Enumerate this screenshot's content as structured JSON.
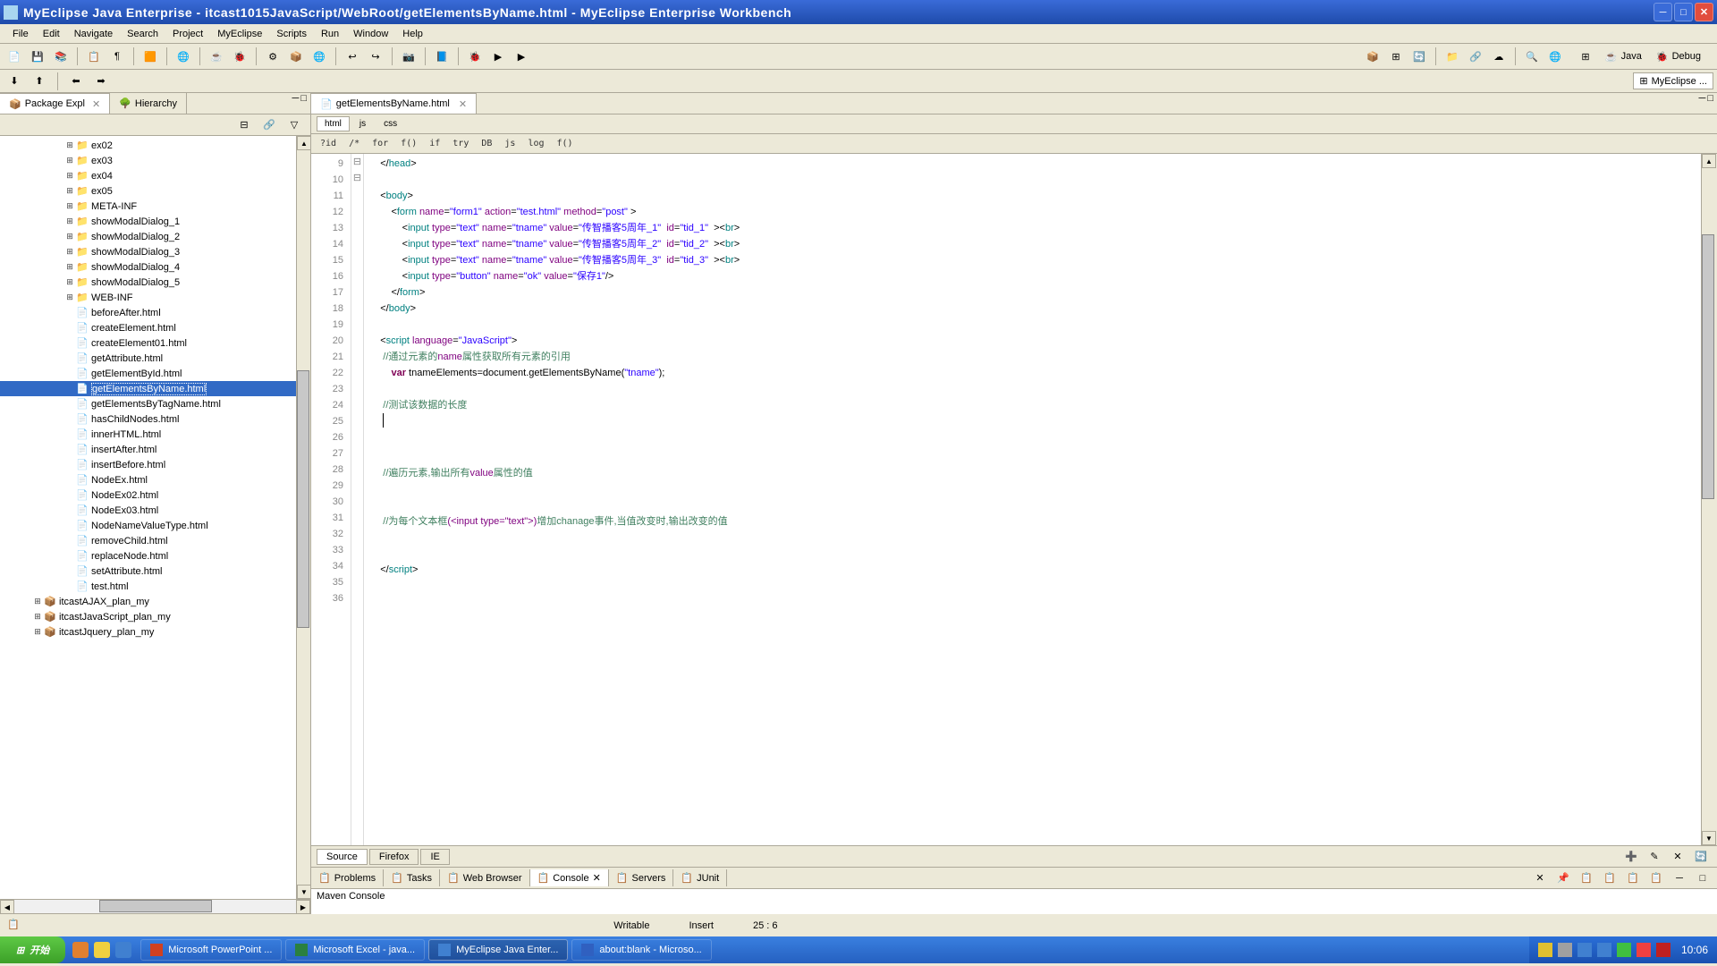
{
  "title": "MyEclipse Java Enterprise - itcast1015JavaScript/WebRoot/getElementsByName.html - MyEclipse Enterprise Workbench",
  "menus": [
    "File",
    "Edit",
    "Navigate",
    "Search",
    "Project",
    "MyEclipse",
    "Scripts",
    "Run",
    "Window",
    "Help"
  ],
  "perspectives": {
    "java": "Java",
    "debug": "Debug",
    "myeclipse": "MyEclipse ..."
  },
  "sidebar": {
    "tab_package": "Package Expl",
    "tab_hierarchy": "Hierarchy",
    "tree": [
      {
        "depth": 4,
        "icon": "folder",
        "label": "ex02",
        "exp": "+"
      },
      {
        "depth": 4,
        "icon": "folder",
        "label": "ex03",
        "exp": "+"
      },
      {
        "depth": 4,
        "icon": "folder",
        "label": "ex04",
        "exp": "+"
      },
      {
        "depth": 4,
        "icon": "folder",
        "label": "ex05",
        "exp": "+"
      },
      {
        "depth": 4,
        "icon": "folder",
        "label": "META-INF",
        "exp": "+"
      },
      {
        "depth": 4,
        "icon": "folder",
        "label": "showModalDialog_1",
        "exp": "+"
      },
      {
        "depth": 4,
        "icon": "folder",
        "label": "showModalDialog_2",
        "exp": "+"
      },
      {
        "depth": 4,
        "icon": "folder",
        "label": "showModalDialog_3",
        "exp": "+"
      },
      {
        "depth": 4,
        "icon": "folder",
        "label": "showModalDialog_4",
        "exp": "+"
      },
      {
        "depth": 4,
        "icon": "folder",
        "label": "showModalDialog_5",
        "exp": "+"
      },
      {
        "depth": 4,
        "icon": "folder",
        "label": "WEB-INF",
        "exp": "+"
      },
      {
        "depth": 4,
        "icon": "file",
        "label": "beforeAfter.html",
        "exp": ""
      },
      {
        "depth": 4,
        "icon": "file",
        "label": "createElement.html",
        "exp": ""
      },
      {
        "depth": 4,
        "icon": "file",
        "label": "createElement01.html",
        "exp": ""
      },
      {
        "depth": 4,
        "icon": "file",
        "label": "getAttribute.html",
        "exp": ""
      },
      {
        "depth": 4,
        "icon": "file",
        "label": "getElementById.html",
        "exp": ""
      },
      {
        "depth": 4,
        "icon": "file",
        "label": "getElementsByName.html",
        "exp": "",
        "selected": true
      },
      {
        "depth": 4,
        "icon": "file",
        "label": "getElementsByTagName.html",
        "exp": ""
      },
      {
        "depth": 4,
        "icon": "file",
        "label": "hasChildNodes.html",
        "exp": ""
      },
      {
        "depth": 4,
        "icon": "file",
        "label": "innerHTML.html",
        "exp": ""
      },
      {
        "depth": 4,
        "icon": "file",
        "label": "insertAfter.html",
        "exp": ""
      },
      {
        "depth": 4,
        "icon": "file",
        "label": "insertBefore.html",
        "exp": ""
      },
      {
        "depth": 4,
        "icon": "file",
        "label": "NodeEx.html",
        "exp": ""
      },
      {
        "depth": 4,
        "icon": "file",
        "label": "NodeEx02.html",
        "exp": ""
      },
      {
        "depth": 4,
        "icon": "file",
        "label": "NodeEx03.html",
        "exp": ""
      },
      {
        "depth": 4,
        "icon": "file",
        "label": "NodeNameValueType.html",
        "exp": ""
      },
      {
        "depth": 4,
        "icon": "file",
        "label": "removeChild.html",
        "exp": ""
      },
      {
        "depth": 4,
        "icon": "file",
        "label": "replaceNode.html",
        "exp": ""
      },
      {
        "depth": 4,
        "icon": "file",
        "label": "setAttribute.html",
        "exp": ""
      },
      {
        "depth": 4,
        "icon": "file",
        "label": "test.html",
        "exp": ""
      },
      {
        "depth": 2,
        "icon": "project",
        "label": "itcastAJAX_plan_my",
        "exp": "+"
      },
      {
        "depth": 2,
        "icon": "project",
        "label": "itcastJavaScript_plan_my",
        "exp": "+"
      },
      {
        "depth": 2,
        "icon": "project",
        "label": "itcastJquery_plan_my",
        "exp": "+"
      }
    ]
  },
  "editor": {
    "tab_label": "getElementsByName.html",
    "lang_tabs": [
      "html",
      "js",
      "css"
    ],
    "mini_toolbar": [
      "?id",
      "/*",
      "for",
      "f()",
      "if",
      "try",
      "DB",
      "js",
      "log",
      "f()"
    ],
    "bottom_tabs": [
      "Source",
      "Firefox",
      "IE"
    ],
    "lines": [
      {
        "n": 9,
        "fold": "",
        "html": "    &lt;/<span class='tag'>head</span>&gt;"
      },
      {
        "n": 10,
        "fold": "",
        "html": ""
      },
      {
        "n": 11,
        "fold": "⊟",
        "html": "    &lt;<span class='tag'>body</span>&gt;"
      },
      {
        "n": 12,
        "fold": "",
        "html": "        &lt;<span class='tag'>form</span> <span class='attr'>name</span>=<span class='str'>\"form1\"</span> <span class='attr'>action</span>=<span class='str'>\"test.html\"</span> <span class='attr'>method</span>=<span class='str'>\"post\"</span> &gt;"
      },
      {
        "n": 13,
        "fold": "",
        "html": "            &lt;<span class='tag'>input</span> <span class='attr'>type</span>=<span class='str'>\"text\"</span> <span class='attr'>name</span>=<span class='str'>\"tname\"</span> <span class='attr'>value</span>=<span class='str'>\"传智播客5周年_1\"</span>  <span class='attr'>id</span>=<span class='str'>\"tid_1\"</span>  &gt;&lt;<span class='tag'>br</span>&gt;"
      },
      {
        "n": 14,
        "fold": "",
        "html": "            &lt;<span class='tag'>input</span> <span class='attr'>type</span>=<span class='str'>\"text\"</span> <span class='attr'>name</span>=<span class='str'>\"tname\"</span> <span class='attr'>value</span>=<span class='str'>\"传智播客5周年_2\"</span>  <span class='attr'>id</span>=<span class='str'>\"tid_2\"</span>  &gt;&lt;<span class='tag'>br</span>&gt;"
      },
      {
        "n": 15,
        "fold": "",
        "html": "            &lt;<span class='tag'>input</span> <span class='attr'>type</span>=<span class='str'>\"text\"</span> <span class='attr'>name</span>=<span class='str'>\"tname\"</span> <span class='attr'>value</span>=<span class='str'>\"传智播客5周年_3\"</span>  <span class='attr'>id</span>=<span class='str'>\"tid_3\"</span>  &gt;&lt;<span class='tag'>br</span>&gt;"
      },
      {
        "n": 16,
        "fold": "",
        "html": "            &lt;<span class='tag'>input</span> <span class='attr'>type</span>=<span class='str'>\"button\"</span> <span class='attr'>name</span>=<span class='str'>\"ok\"</span> <span class='attr'>value</span>=<span class='str'>\"保存1\"</span>/&gt;"
      },
      {
        "n": 17,
        "fold": "",
        "html": "        &lt;/<span class='tag'>form</span>&gt;"
      },
      {
        "n": 18,
        "fold": "",
        "html": "    &lt;/<span class='tag'>body</span>&gt;"
      },
      {
        "n": 19,
        "fold": "",
        "html": ""
      },
      {
        "n": 20,
        "fold": "⊟",
        "html": "    &lt;<span class='tag'>script</span> <span class='attr'>language</span>=<span class='str'>\"JavaScript\"</span>&gt;"
      },
      {
        "n": 21,
        "fold": "",
        "html": "     <span class='com'>//通过元素的</span><span class='com-hl'>name</span><span class='com'>属性获取所有元素的引用</span>"
      },
      {
        "n": 22,
        "fold": "",
        "html": "        <span class='kw'>var</span> tnameElements=document.getElementsByName(<span class='str'>\"tname\"</span>);"
      },
      {
        "n": 23,
        "fold": "",
        "html": ""
      },
      {
        "n": 24,
        "fold": "",
        "html": "     <span class='com'>//测试该数据的长度</span>"
      },
      {
        "n": 25,
        "fold": "",
        "html": "     <span class='text-cursor'></span>"
      },
      {
        "n": 26,
        "fold": "",
        "html": ""
      },
      {
        "n": 27,
        "fold": "",
        "html": ""
      },
      {
        "n": 28,
        "fold": "",
        "html": "     <span class='com'>//遍历元素,输出所有</span><span class='com-hl'>value</span><span class='com'>属性的值</span>"
      },
      {
        "n": 29,
        "fold": "",
        "html": ""
      },
      {
        "n": 30,
        "fold": "",
        "html": ""
      },
      {
        "n": 31,
        "fold": "",
        "html": "     <span class='com'>//为每个文本框</span><span class='com-hl'>(&lt;input type=\"text\"&gt;)</span><span class='com'>增加chanage事件,当值改变时,输出改变的值</span>"
      },
      {
        "n": 32,
        "fold": "",
        "html": ""
      },
      {
        "n": 33,
        "fold": "",
        "html": ""
      },
      {
        "n": 34,
        "fold": "",
        "html": "    &lt;/<span class='tag'>script</span>&gt;"
      },
      {
        "n": 35,
        "fold": "",
        "html": ""
      },
      {
        "n": 36,
        "fold": "",
        "html": ""
      }
    ]
  },
  "bottom_panel": {
    "tabs": [
      "Problems",
      "Tasks",
      "Web Browser",
      "Console",
      "Servers",
      "JUnit"
    ],
    "content": "Maven Console"
  },
  "status": {
    "writable": "Writable",
    "insert": "Insert",
    "pos": "25 : 6"
  },
  "taskbar": {
    "start": "开始",
    "tasks": [
      {
        "label": "Microsoft PowerPoint ...",
        "icon": "#d04020"
      },
      {
        "label": "Microsoft Excel - java...",
        "icon": "#2a8040"
      },
      {
        "label": "MyEclipse Java Enter...",
        "icon": "#4080d0",
        "active": true
      },
      {
        "label": "about:blank - Microso...",
        "icon": "#3060c0"
      }
    ],
    "clock": "10:06"
  }
}
